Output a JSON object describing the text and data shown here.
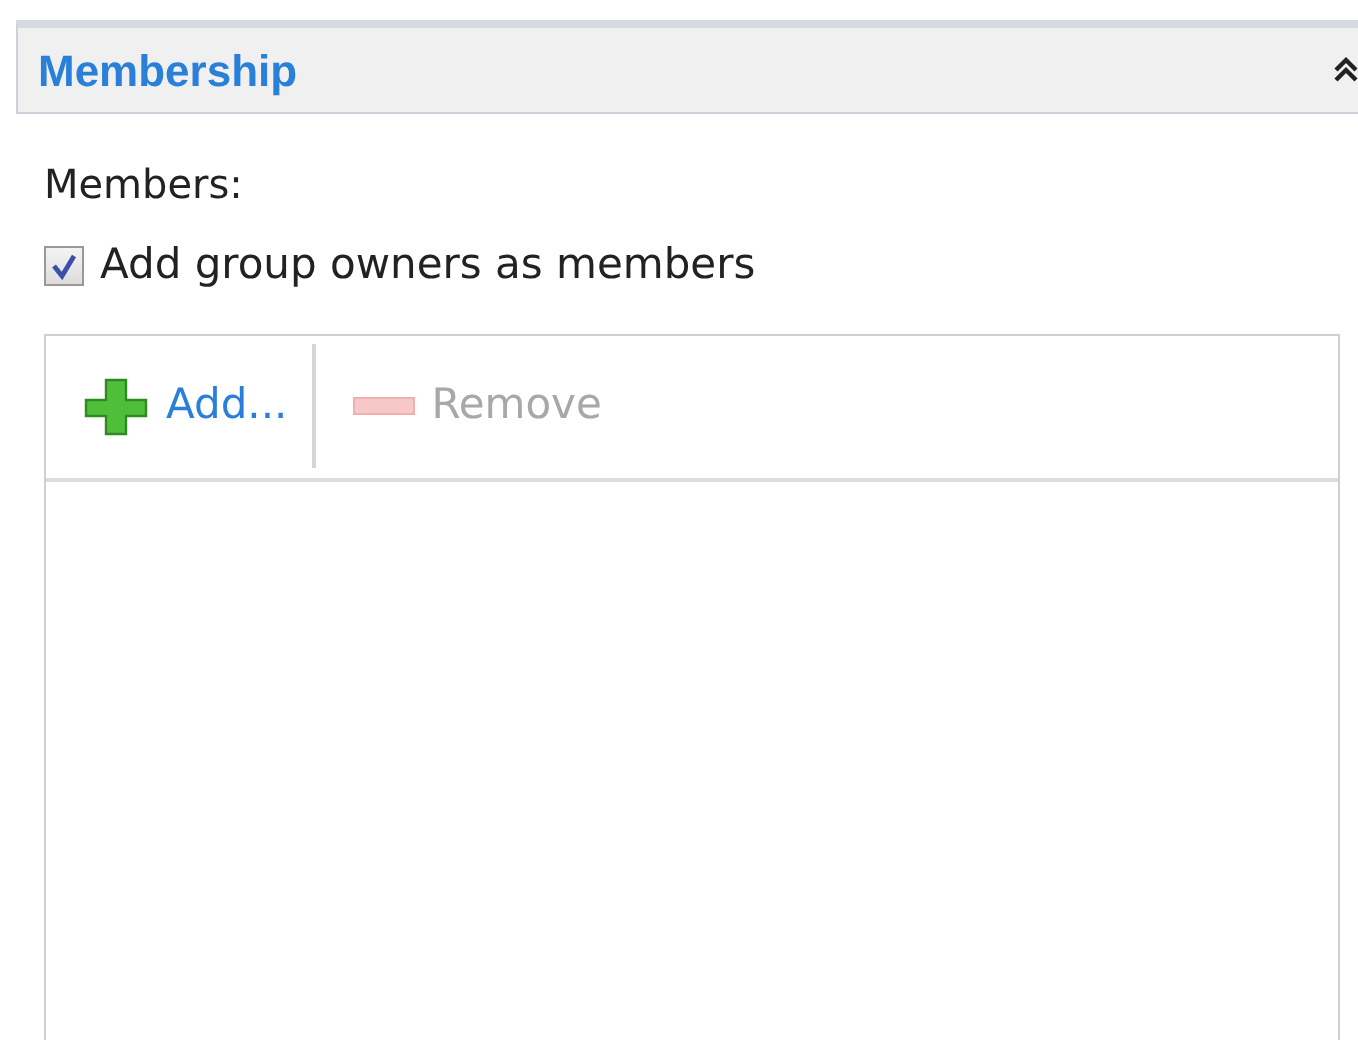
{
  "section": {
    "title": "Membership",
    "expanded": true
  },
  "members_label": "Members:",
  "checkbox": {
    "label": "Add group owners as members",
    "checked": true
  },
  "toolbar": [
    {
      "kind": "add",
      "label": "Add...",
      "disabled": false
    },
    {
      "kind": "remove",
      "label": "Remove",
      "disabled": true
    }
  ]
}
